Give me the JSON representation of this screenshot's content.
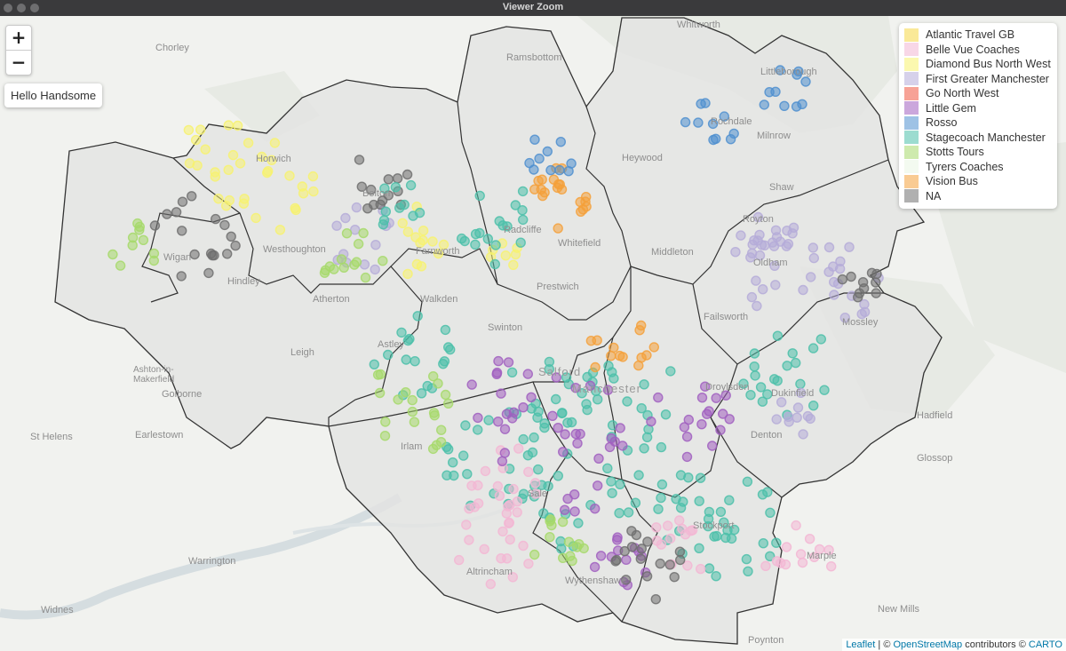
{
  "window": {
    "title": "Viewer Zoom"
  },
  "zoom": {
    "in_label": "+",
    "out_label": "−"
  },
  "popup": {
    "text": "Hello Handsome"
  },
  "legend": [
    {
      "label": "Atlantic Travel GB",
      "color": "#f6d743"
    },
    {
      "label": "Belle Vue Coaches",
      "color": "#f3b6d4"
    },
    {
      "label": "Diamond Bus North West",
      "color": "#f7f26e"
    },
    {
      "label": "First Greater Manchester",
      "color": "#b5acd8"
    },
    {
      "label": "Go North West",
      "color": "#f0553f"
    },
    {
      "label": "Little Gem",
      "color": "#a05fbf"
    },
    {
      "label": "Rosso",
      "color": "#4f8fcf"
    },
    {
      "label": "Stagecoach Manchester",
      "color": "#4bbfa9"
    },
    {
      "label": "Stotts Tours",
      "color": "#a6d96a"
    },
    {
      "label": "Tyrers Coaches",
      "color": "#ffffff"
    },
    {
      "label": "Vision Bus",
      "color": "#f4a03a"
    },
    {
      "label": "NA",
      "color": "#6f6f6f"
    }
  ],
  "places": [
    {
      "name": "Whitworth"
    },
    {
      "name": "Chorley"
    },
    {
      "name": "Ramsbottom"
    },
    {
      "name": "Littleborough"
    },
    {
      "name": "Horwich"
    },
    {
      "name": "Rochdale"
    },
    {
      "name": "Milnrow"
    },
    {
      "name": "Heywood"
    },
    {
      "name": "Shaw"
    },
    {
      "name": "Royton"
    },
    {
      "name": "Radcliffe"
    },
    {
      "name": "Whitefield"
    },
    {
      "name": "Middleton"
    },
    {
      "name": "Oldham"
    },
    {
      "name": "Westhoughton"
    },
    {
      "name": "Bolton"
    },
    {
      "name": "Farnworth"
    },
    {
      "name": "Wigan"
    },
    {
      "name": "Hindley"
    },
    {
      "name": "Atherton"
    },
    {
      "name": "Walkden"
    },
    {
      "name": "Prestwich"
    },
    {
      "name": "Failsworth"
    },
    {
      "name": "Mossley"
    },
    {
      "name": "Swinton"
    },
    {
      "name": "Astley"
    },
    {
      "name": "Leigh"
    },
    {
      "name": "Salford"
    },
    {
      "name": "Manchester"
    },
    {
      "name": "Droylsden"
    },
    {
      "name": "Dukinfield"
    },
    {
      "name": "Ashton-in-Makerfield"
    },
    {
      "name": "Golborne"
    },
    {
      "name": "Hadfield"
    },
    {
      "name": "St Helens"
    },
    {
      "name": "Earlestown"
    },
    {
      "name": "Irlam"
    },
    {
      "name": "Denton"
    },
    {
      "name": "Glossop"
    },
    {
      "name": "Stockport"
    },
    {
      "name": "Warrington"
    },
    {
      "name": "Altrincham"
    },
    {
      "name": "Wythenshawe"
    },
    {
      "name": "Marple"
    },
    {
      "name": "Widnes"
    },
    {
      "name": "New Mills"
    },
    {
      "name": "Poynton"
    },
    {
      "name": "Sale"
    }
  ],
  "attribution": {
    "leaflet": "Leaflet",
    "sep": " | © ",
    "osm": "OpenStreetMap",
    "mid": " contributors © ",
    "carto": "CARTO"
  }
}
